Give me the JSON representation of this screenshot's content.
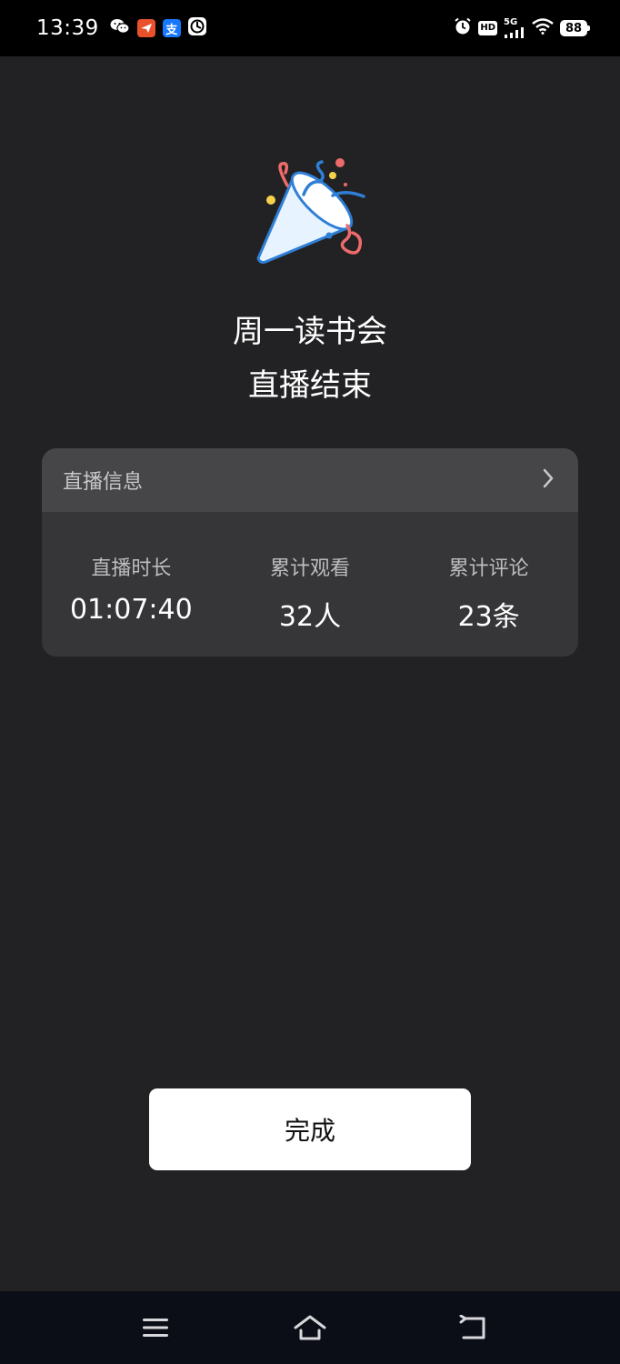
{
  "status_bar": {
    "time": "13:39",
    "left_icons": [
      "wechat-icon",
      "email-app-icon",
      "alipay-icon",
      "app-circle-icon"
    ],
    "alipay_glyph": "支",
    "right_icons": [
      "alarm-icon",
      "hd-icon",
      "signal-5g-icon",
      "wifi-icon",
      "battery-icon"
    ],
    "hd_label": "HD",
    "network_label": "5G",
    "battery_level": "88"
  },
  "hero": {
    "icon": "party-popper-icon",
    "title_line1": "周一读书会",
    "title_line2": "直播结束"
  },
  "info_card": {
    "header_label": "直播信息",
    "stats": [
      {
        "label": "直播时长",
        "value": "01:07:40"
      },
      {
        "label": "累计观看",
        "value": "32人"
      },
      {
        "label": "累计评论",
        "value": "23条"
      }
    ]
  },
  "done_button": {
    "label": "完成"
  },
  "nav_bar": {
    "icons": [
      "menu-icon",
      "home-icon",
      "back-icon"
    ]
  },
  "colors": {
    "background": "#222224",
    "card": "#363638",
    "card_header": "#464648",
    "button": "#ffffff",
    "nav_bar": "#0b0e16"
  }
}
